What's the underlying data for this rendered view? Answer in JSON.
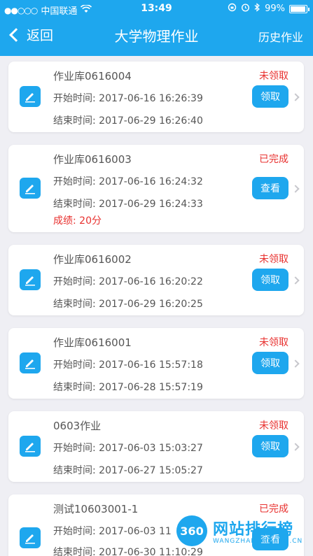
{
  "status_bar": {
    "carrier": "中国联通",
    "time": "13:49",
    "battery": "99%"
  },
  "nav": {
    "back_label": "返回",
    "title": "大学物理作业",
    "history_label": "历史作业"
  },
  "cards": [
    {
      "name": "作业库0616004",
      "status": "未领取",
      "start": "开始时间:  2017-06-16 16:26:39",
      "end": "结束时间:  2017-06-29 16:26:40",
      "action": "领取"
    },
    {
      "name": "作业库0616003",
      "status": "已完成",
      "start": "开始时间:  2017-06-16 16:24:32",
      "end": "结束时间:  2017-06-29 16:24:33",
      "score": "成绩:  20分",
      "action": "查看"
    },
    {
      "name": "作业库0616002",
      "status": "未领取",
      "start": "开始时间:  2017-06-16 16:20:22",
      "end": "结束时间:  2017-06-29 16:20:25",
      "action": "领取"
    },
    {
      "name": "作业库0616001",
      "status": "未领取",
      "start": "开始时间:  2017-06-16 15:57:18",
      "end": "结束时间:  2017-06-28 15:57:19",
      "action": "领取"
    },
    {
      "name": "0603作业",
      "status": "未领取",
      "start": "开始时间:  2017-06-03 15:03:27",
      "end": "结束时间:  2017-06-27 15:05:27",
      "action": "领取"
    },
    {
      "name": "测试10603001-1",
      "status": "已完成",
      "start": "开始时间:  2017-06-03 11",
      "end": "结束时间:  2017-06-30 11:10:29",
      "action": "查看"
    }
  ],
  "watermark": {
    "logo": "360",
    "text": "网站排行榜",
    "sub": "WANGZHANPAIHANG.CN"
  },
  "colors": {
    "accent": "#1ea7ee",
    "alert": "#e8312f",
    "background": "#efeff4"
  }
}
